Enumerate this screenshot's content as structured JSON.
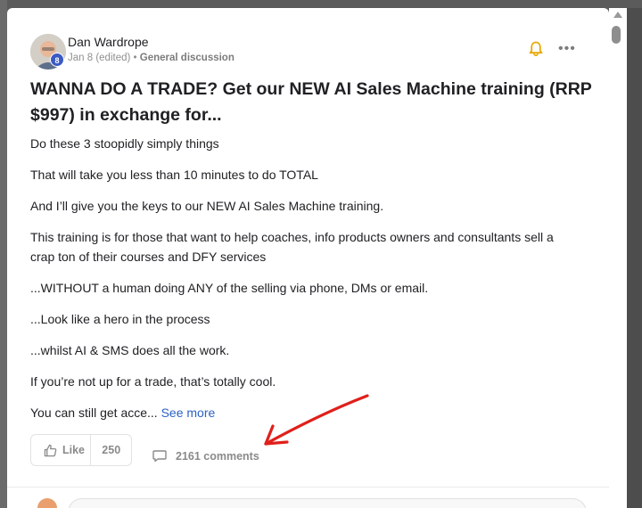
{
  "post": {
    "author": "Dan Wardrope",
    "level": "8",
    "date": "Jan 8 (edited)",
    "separator": "•",
    "category": "General discussion",
    "title": "WANNA DO A TRADE? Get our NEW AI Sales Machine training (RRP $997) in exchange for...",
    "paragraphs": [
      "Do these 3 stoopidly simply things",
      "That will take you less than 10 minutes to do TOTAL",
      "And I’ll give you the keys to our NEW AI Sales Machine training.",
      "This training is for those that want to help coaches, info products owners and consultants sell a crap ton of their courses and DFY services",
      "...WITHOUT a human doing ANY of the selling via phone, DMs or email.",
      "...Look like a hero in the process",
      "...whilst AI & SMS does all the work.",
      "If you’re not up for a trade, that’s totally cool.",
      "You can still get acce..."
    ],
    "see_more": "See more",
    "more_menu": "•••"
  },
  "actions": {
    "like_label": "Like",
    "like_count": "250",
    "comments_label": "2161 comments"
  },
  "icons": {
    "bell": "bell-icon",
    "more": "more-horizontal-icon",
    "like": "thumbs-up-icon",
    "comment": "comment-bubble-icon",
    "scroll_up": "scroll-up-arrow-icon"
  },
  "colors": {
    "accent_link": "#2c61c6",
    "bell": "#f0b400",
    "level_badge": "#3b5bc4",
    "annotation_arrow": "#e0201b"
  }
}
